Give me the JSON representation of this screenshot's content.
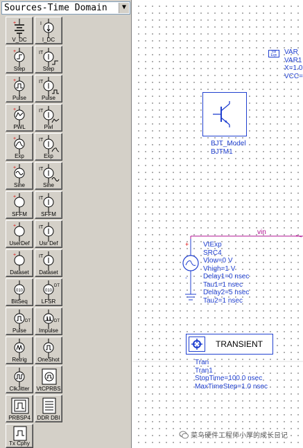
{
  "palette": {
    "library_name": "Sources-Time Domain",
    "items": [
      {
        "label": "V_DC",
        "icon": "v-dc-icon"
      },
      {
        "label": "I_DC",
        "icon": "i-dc-icon"
      },
      {
        "label": "Step",
        "icon": "v-step-icon"
      },
      {
        "label": "Step",
        "icon": "i-step-icon"
      },
      {
        "label": "Pulse",
        "icon": "v-pulse-icon"
      },
      {
        "label": "Pulse",
        "icon": "i-pulse-icon"
      },
      {
        "label": "PWL",
        "icon": "v-pwl-icon"
      },
      {
        "label": "Pwl",
        "icon": "i-pwl-icon"
      },
      {
        "label": "Exp",
        "icon": "v-exp-icon"
      },
      {
        "label": "Exp",
        "icon": "i-exp-icon"
      },
      {
        "label": "Sine",
        "icon": "v-sine-icon"
      },
      {
        "label": "Sine",
        "icon": "i-sine-icon"
      },
      {
        "label": "SFFM",
        "icon": "v-sffm-icon"
      },
      {
        "label": "SFFM",
        "icon": "i-sffm-icon"
      },
      {
        "label": "UserDef",
        "icon": "v-userdef-icon"
      },
      {
        "label": "Usr Def",
        "icon": "i-userdef-icon"
      },
      {
        "label": "Dataset",
        "icon": "v-dataset-icon"
      },
      {
        "label": "Dataset",
        "icon": "i-dataset-icon"
      },
      {
        "label": "BitSeq",
        "icon": "bitseq-icon"
      },
      {
        "label": "LFSR",
        "icon": "lfsr-icon"
      },
      {
        "label": "Pulse",
        "icon": "dt-pulse-icon"
      },
      {
        "label": "Impulse",
        "icon": "dt-impulse-icon"
      },
      {
        "label": "Retrig",
        "icon": "retrig-icon"
      },
      {
        "label": "OneShot",
        "icon": "oneshot-icon"
      },
      {
        "label": "ClkJitter",
        "icon": "clkjitter-icon"
      },
      {
        "label": "VtCPRBS",
        "icon": "vtcprbs-icon"
      },
      {
        "label": "PRBSP4",
        "icon": "prbsp4-icon"
      },
      {
        "label": "DDR DBI",
        "icon": "ddr-dbi-icon"
      },
      {
        "label": "Tx Cphy",
        "icon": "tx-cphy-icon"
      }
    ]
  },
  "canvas": {
    "var_block": {
      "badge": "Var Eqn",
      "lines": [
        "VAR",
        "VAR1",
        "X=1.0",
        "VCC="
      ]
    },
    "bjt_model": {
      "type": "BJT_Model",
      "name": "BJTM1"
    },
    "wire_label": "vin",
    "source": {
      "plus": "+",
      "minus": "-",
      "lines": [
        "VtExp",
        "SRC4",
        "Vlow=0 V",
        "Vhigh=1 V",
        "Delay1=0 nsec",
        "Tau1=1 nsec",
        "Delay2=5 nsec",
        "Tau2=1 nsec"
      ]
    },
    "transient": {
      "title": "TRANSIENT",
      "lines": [
        "Tran",
        "Tran1",
        "StopTime=100.0 nsec",
        "MaxTimeStep=1.0 nsec"
      ]
    }
  },
  "watermark": "菜鸟硬件工程师小厚的成长日记",
  "colors": {
    "wire": "#b01090",
    "component": "#1f3fcf",
    "palette_bg": "#d4d0c8"
  }
}
